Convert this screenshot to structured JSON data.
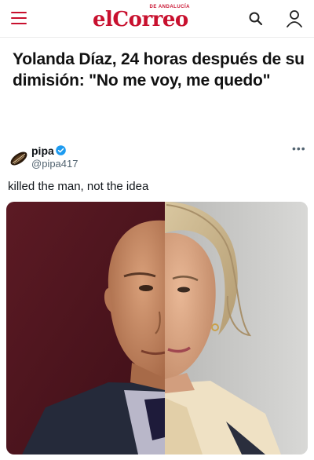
{
  "header": {
    "logo_tagline": "DE ANDALUCÍA",
    "logo_text": "elCorreo",
    "brand_color": "#c8102e"
  },
  "article": {
    "headline": "Yolanda Díaz, 24 horas después de su dimisión: \"No me voy, me quedo\""
  },
  "tweet": {
    "author_name": "pipa",
    "author_handle": "@pipa417",
    "verified": true,
    "text": "killed the man, not the idea",
    "more_label": "•••",
    "media_description_icon": "photo-icon"
  }
}
